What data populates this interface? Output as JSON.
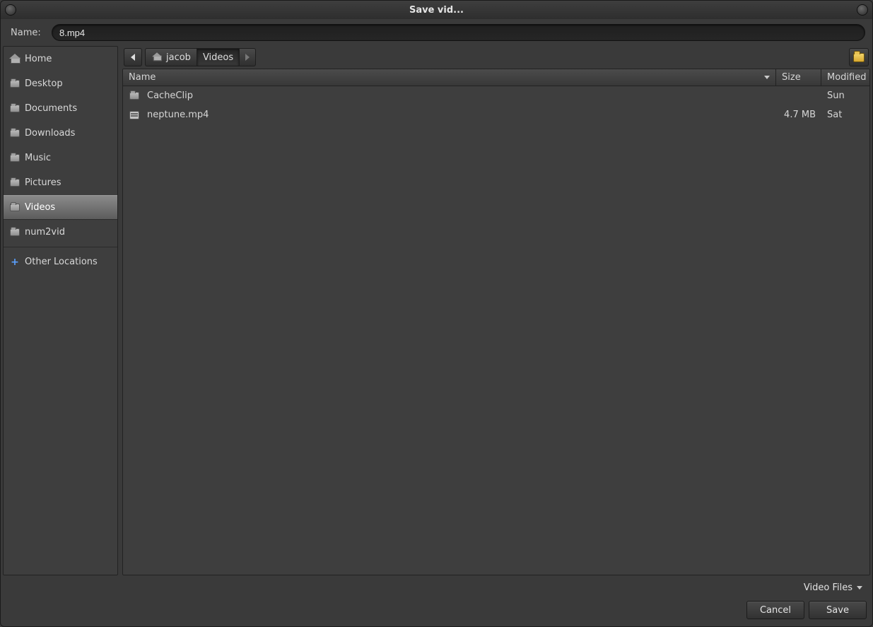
{
  "window": {
    "title": "Save vid..."
  },
  "name_row": {
    "label": "Name:",
    "value": "8.mp4"
  },
  "sidebar": {
    "items": [
      {
        "label": "Home",
        "icon": "home",
        "selected": false
      },
      {
        "label": "Desktop",
        "icon": "folder",
        "selected": false
      },
      {
        "label": "Documents",
        "icon": "folder",
        "selected": false
      },
      {
        "label": "Downloads",
        "icon": "folder",
        "selected": false
      },
      {
        "label": "Music",
        "icon": "folder",
        "selected": false
      },
      {
        "label": "Pictures",
        "icon": "folder",
        "selected": false
      },
      {
        "label": "Videos",
        "icon": "folder",
        "selected": true
      },
      {
        "label": "num2vid",
        "icon": "folder",
        "selected": false
      }
    ],
    "other": {
      "label": "Other Locations",
      "icon": "plus"
    }
  },
  "pathbar": {
    "crumbs": [
      {
        "label": "jacob",
        "icon": "home",
        "active": false
      },
      {
        "label": "Videos",
        "icon": null,
        "active": true
      }
    ]
  },
  "columns": {
    "name": "Name",
    "size": "Size",
    "modified": "Modified"
  },
  "files": [
    {
      "name": "CacheClip",
      "icon": "folder",
      "size": "",
      "modified": "Sun"
    },
    {
      "name": "neptune.mp4",
      "icon": "video",
      "size": "4.7 MB",
      "modified": "Sat"
    }
  ],
  "footer": {
    "filter_label": "Video Files",
    "cancel": "Cancel",
    "save": "Save"
  }
}
